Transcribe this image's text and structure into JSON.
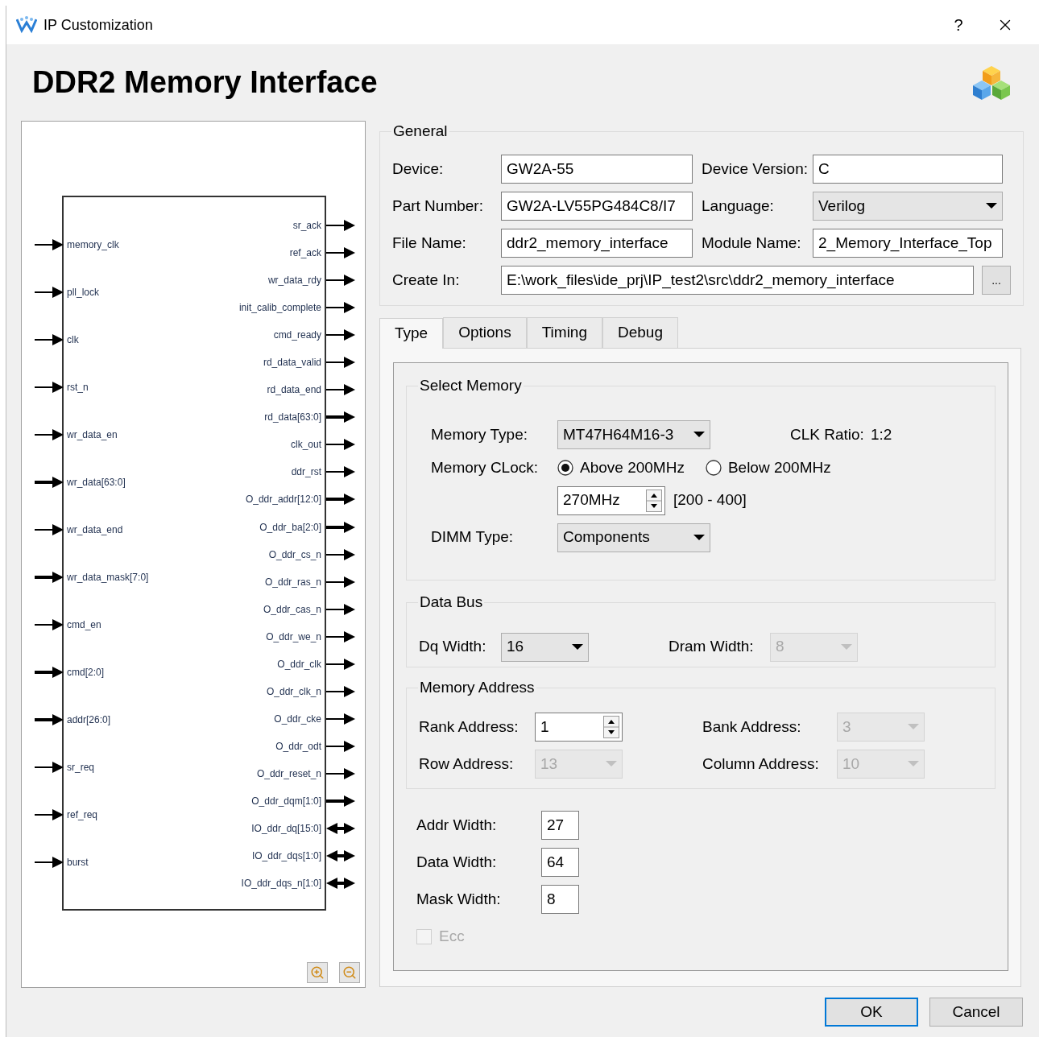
{
  "window": {
    "title": "IP Customization",
    "help": "?"
  },
  "header": {
    "title": "DDR2 Memory Interface"
  },
  "diagram": {
    "inputs": [
      {
        "name": "memory_clk",
        "bus": false
      },
      {
        "name": "pll_lock",
        "bus": false
      },
      {
        "name": "clk",
        "bus": false
      },
      {
        "name": "rst_n",
        "bus": false
      },
      {
        "name": "wr_data_en",
        "bus": false
      },
      {
        "name": "wr_data[63:0]",
        "bus": true
      },
      {
        "name": "wr_data_end",
        "bus": false
      },
      {
        "name": "wr_data_mask[7:0]",
        "bus": true
      },
      {
        "name": "cmd_en",
        "bus": false
      },
      {
        "name": "cmd[2:0]",
        "bus": true
      },
      {
        "name": "addr[26:0]",
        "bus": true
      },
      {
        "name": "sr_req",
        "bus": false
      },
      {
        "name": "ref_req",
        "bus": false
      },
      {
        "name": "burst",
        "bus": false
      }
    ],
    "outputs": [
      {
        "name": "sr_ack",
        "kind": "out",
        "bus": false
      },
      {
        "name": "ref_ack",
        "kind": "out",
        "bus": false
      },
      {
        "name": "wr_data_rdy",
        "kind": "out",
        "bus": false
      },
      {
        "name": "init_calib_complete",
        "kind": "out",
        "bus": false
      },
      {
        "name": "cmd_ready",
        "kind": "out",
        "bus": false
      },
      {
        "name": "rd_data_valid",
        "kind": "out",
        "bus": false
      },
      {
        "name": "rd_data_end",
        "kind": "out",
        "bus": false
      },
      {
        "name": "rd_data[63:0]",
        "kind": "out",
        "bus": true
      },
      {
        "name": "clk_out",
        "kind": "out",
        "bus": false
      },
      {
        "name": "ddr_rst",
        "kind": "out",
        "bus": false
      },
      {
        "name": "O_ddr_addr[12:0]",
        "kind": "out",
        "bus": true
      },
      {
        "name": "O_ddr_ba[2:0]",
        "kind": "out",
        "bus": true
      },
      {
        "name": "O_ddr_cs_n",
        "kind": "out",
        "bus": false
      },
      {
        "name": "O_ddr_ras_n",
        "kind": "out",
        "bus": false
      },
      {
        "name": "O_ddr_cas_n",
        "kind": "out",
        "bus": false
      },
      {
        "name": "O_ddr_we_n",
        "kind": "out",
        "bus": false
      },
      {
        "name": "O_ddr_clk",
        "kind": "out",
        "bus": false
      },
      {
        "name": "O_ddr_clk_n",
        "kind": "out",
        "bus": false
      },
      {
        "name": "O_ddr_cke",
        "kind": "out",
        "bus": false
      },
      {
        "name": "O_ddr_odt",
        "kind": "out",
        "bus": false
      },
      {
        "name": "O_ddr_reset_n",
        "kind": "out",
        "bus": false
      },
      {
        "name": "O_ddr_dqm[1:0]",
        "kind": "out",
        "bus": true
      },
      {
        "name": "IO_ddr_dq[15:0]",
        "kind": "inout",
        "bus": true
      },
      {
        "name": "IO_ddr_dqs[1:0]",
        "kind": "inout",
        "bus": true
      },
      {
        "name": "IO_ddr_dqs_n[1:0]",
        "kind": "inout",
        "bus": true
      }
    ]
  },
  "general": {
    "title": "General",
    "rows": [
      [
        {
          "label": "Device:",
          "value": "GW2A-55",
          "kind": "text"
        },
        {
          "label": "Device Version:",
          "value": "C",
          "kind": "text"
        }
      ],
      [
        {
          "label": "Part Number:",
          "value": "GW2A-LV55PG484C8/I7",
          "kind": "text"
        },
        {
          "label": "Language:",
          "value": "Verilog",
          "kind": "dropdown"
        }
      ],
      [
        {
          "label": "File Name:",
          "value": "ddr2_memory_interface",
          "kind": "text"
        },
        {
          "label": "Module Name:",
          "value": "2_Memory_Interface_Top",
          "kind": "text"
        }
      ]
    ],
    "create_in": {
      "label": "Create In:",
      "value": "E:\\work_files\\ide_prj\\IP_test2\\src\\ddr2_memory_interface",
      "button": "..."
    }
  },
  "tabs": [
    {
      "label": "Type",
      "selected": true
    },
    {
      "label": "Options",
      "selected": false
    },
    {
      "label": "Timing",
      "selected": false
    },
    {
      "label": "Debug",
      "selected": false
    }
  ],
  "select_memory": {
    "title": "Select Memory",
    "memory_type": {
      "label": "Memory Type:",
      "value": "MT47H64M16-3"
    },
    "clk_ratio": {
      "label": "CLK Ratio:",
      "value": "1:2"
    },
    "memory_clock": {
      "label": "Memory CLock:",
      "options": [
        {
          "label": "Above 200MHz",
          "selected": true
        },
        {
          "label": "Below 200MHz",
          "selected": false
        }
      ],
      "value": "270MHz",
      "range": "[200 - 400]"
    },
    "dimm_type": {
      "label": "DIMM Type:",
      "value": "Components"
    }
  },
  "data_bus": {
    "title": "Data Bus",
    "dq_width": {
      "label": "Dq Width:",
      "value": "16",
      "disabled": false
    },
    "dram_width": {
      "label": "Dram Width:",
      "value": "8",
      "disabled": true
    }
  },
  "memory_address": {
    "title": "Memory Address",
    "rank_address": {
      "label": "Rank Address:",
      "value": "1"
    },
    "bank_address": {
      "label": "Bank Address:",
      "value": "3",
      "disabled": true
    },
    "row_address": {
      "label": "Row Address:",
      "value": "13",
      "disabled": true
    },
    "column_address": {
      "label": "Column Address:",
      "value": "10",
      "disabled": true
    }
  },
  "widths": [
    {
      "label": "Addr Width:",
      "value": "27"
    },
    {
      "label": "Data Width:",
      "value": "64"
    },
    {
      "label": "Mask Width:",
      "value": "8"
    }
  ],
  "ecc": {
    "label": "Ecc",
    "checked": false,
    "disabled": true
  },
  "buttons": [
    {
      "label": "OK",
      "default": true
    },
    {
      "label": "Cancel",
      "default": false
    }
  ]
}
